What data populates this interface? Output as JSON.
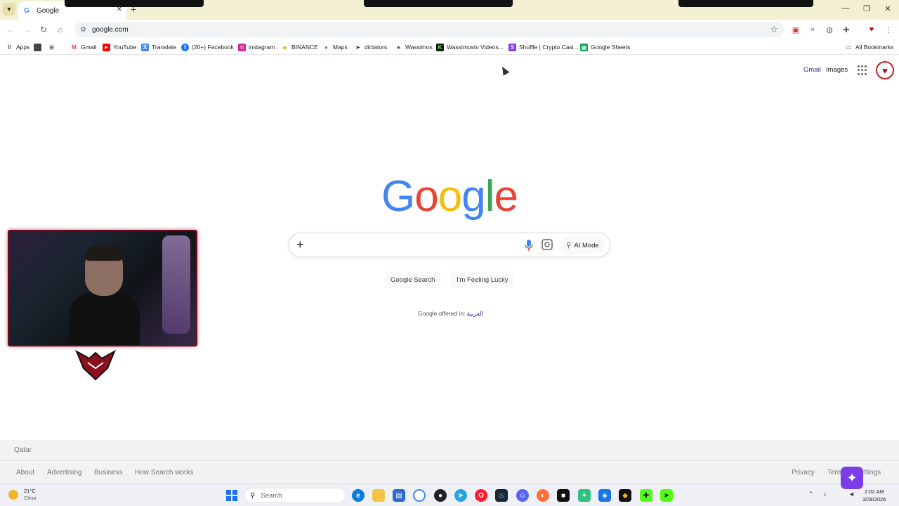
{
  "browser": {
    "tab_title": "Google",
    "url": "google.com",
    "bookmarks": [
      {
        "label": "Apps",
        "icon": "apps-icon"
      },
      {
        "label": "Gmail",
        "icon": "gmail-icon"
      },
      {
        "label": "YouTube",
        "icon": "youtube-icon"
      },
      {
        "label": "Translate",
        "icon": "translate-icon"
      },
      {
        "label": "(20+) Facebook",
        "icon": "facebook-icon"
      },
      {
        "label": "instagram",
        "icon": "instagram-icon"
      },
      {
        "label": "BINANCE",
        "icon": "binance-icon"
      },
      {
        "label": "Maps",
        "icon": "maps-icon"
      },
      {
        "label": "dictators",
        "icon": "dictators-icon"
      },
      {
        "label": "Wassimos",
        "icon": "leaf-icon"
      },
      {
        "label": "Wassimostv Videos...",
        "icon": "kick-icon"
      },
      {
        "label": "Shuffle | Crypto Casi...",
        "icon": "shuffle-icon"
      },
      {
        "label": "Google Sheets",
        "icon": "sheets-icon"
      }
    ],
    "all_bookmarks": "All Bookmarks",
    "colors": {
      "accent": "#4285f4",
      "tabbar": "#f3efd2"
    }
  },
  "google": {
    "header": {
      "gmail": "Gmail",
      "images": "Images"
    },
    "logo_letters": [
      "G",
      "o",
      "o",
      "g",
      "l",
      "e"
    ],
    "search_plus": "+",
    "ai_mode": "AI Mode",
    "buttons": {
      "search": "Google Search",
      "lucky": "I'm Feeling Lucky"
    },
    "offered_prefix": "Google offered in:",
    "offered_lang": "العربية",
    "footer": {
      "country": "Qatar",
      "left_links": [
        "About",
        "Advertising",
        "Business",
        "How Search works"
      ],
      "right_links": [
        "Privacy",
        "Terms",
        "Settings"
      ]
    }
  },
  "taskbar": {
    "weather_temp": "21°C",
    "weather_desc": "Clear",
    "search_placeholder": "Search",
    "time": "2:02 AM",
    "date": "3/29/2026"
  }
}
